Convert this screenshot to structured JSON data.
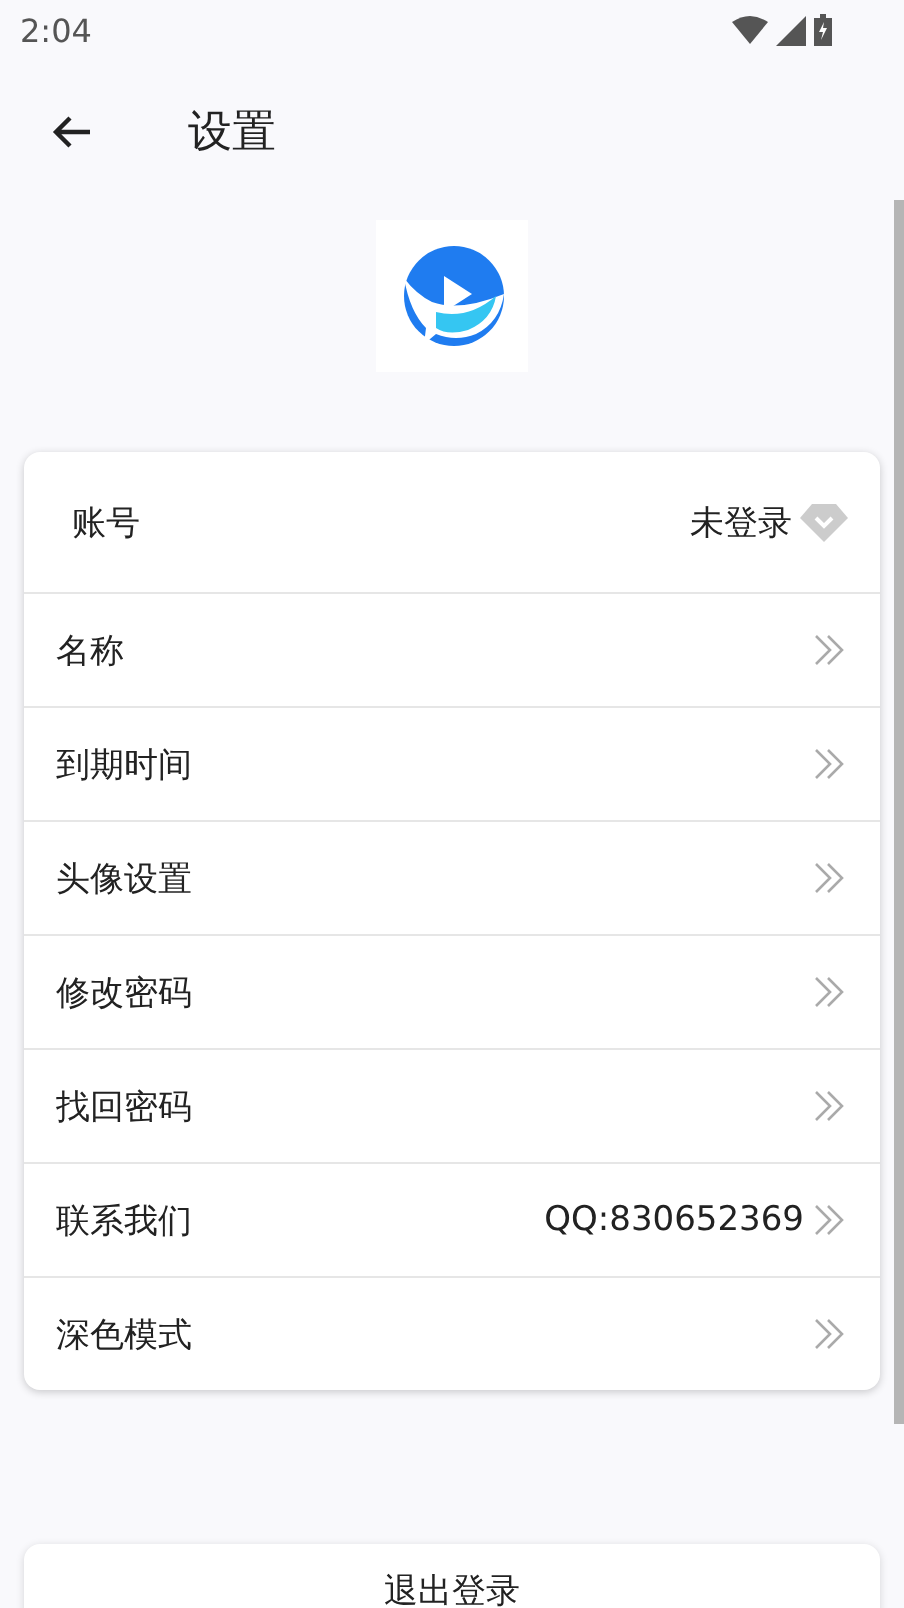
{
  "status_bar": {
    "time": "2:04"
  },
  "header": {
    "title": "设置"
  },
  "settings": [
    {
      "kind": "account",
      "label": "账号",
      "value": "未登录"
    },
    {
      "kind": "link",
      "label": "名称"
    },
    {
      "kind": "link",
      "label": "到期时间"
    },
    {
      "kind": "link",
      "label": "头像设置"
    },
    {
      "kind": "link",
      "label": "修改密码"
    },
    {
      "kind": "link",
      "label": "找回密码"
    },
    {
      "kind": "link",
      "label": "联系我们",
      "value": "QQ:830652369"
    },
    {
      "kind": "link",
      "label": "深色模式"
    }
  ],
  "logout_button": {
    "label": "退出登录"
  }
}
